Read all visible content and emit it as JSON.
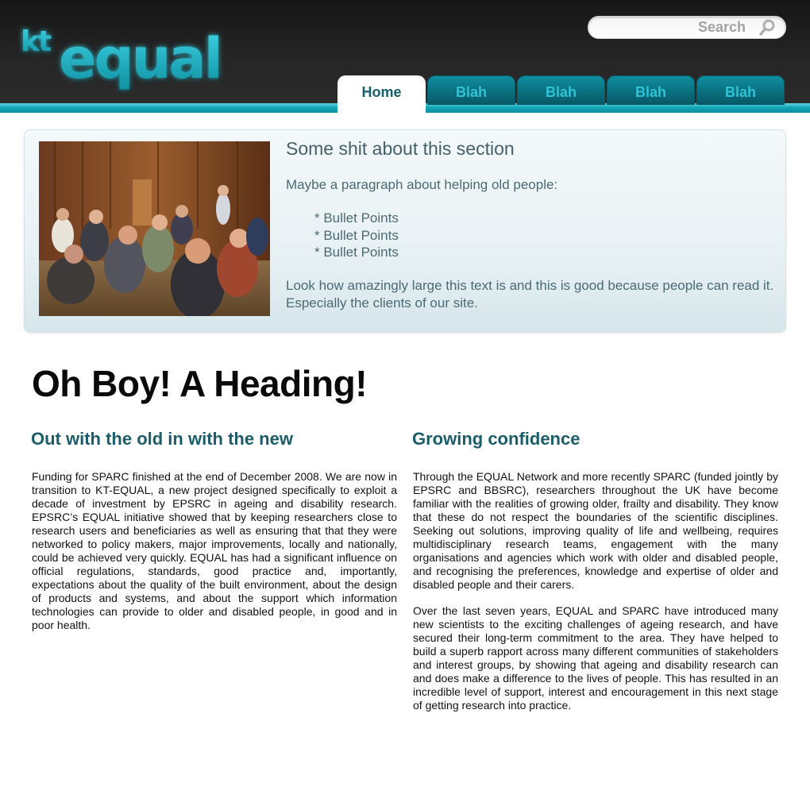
{
  "header": {
    "logo": {
      "prefix": "kt",
      "name": "equal"
    },
    "search": {
      "placeholder": "Search"
    },
    "tabs": [
      {
        "label": "Home",
        "active": true
      },
      {
        "label": "Blah",
        "active": false
      },
      {
        "label": "Blah",
        "active": false
      },
      {
        "label": "Blah",
        "active": false
      },
      {
        "label": "Blah",
        "active": false
      }
    ]
  },
  "intro": {
    "title": "Some shit about this section",
    "lead": "Maybe a paragraph about helping old people:",
    "bullets": [
      "* Bullet Points",
      "* Bullet Points",
      "* Bullet Points"
    ],
    "closing": "Look how amazingly large this text is and this is good because people can read it. Especially the clients of our site."
  },
  "main": {
    "heading": "Oh Boy! A Heading!",
    "columns": [
      {
        "title": "Out with the old in with the new",
        "paragraphs": [
          "Funding for SPARC finished at the end of December 2008. We are now in transition to KT-EQUAL, a new project designed specifically to exploit a decade of investment by EPSRC in ageing and disability research. EPSRC’s EQUAL initiative showed that by keeping researchers close to research users and beneficiaries as well as ensuring that that they were net­worked to policy makers, major improvements, locally and nationally, could be achieved very quickly. EQUAL has had a significant influence on official regulations, standards, good practice and, importantly, expectations about the quality of the built environment, about the design of products and sys­tems, and about the support which information technologies can provide to older and disabled people, in good and in poor health."
        ]
      },
      {
        "title": "Growing confidence",
        "paragraphs": [
          "Through the EQUAL Network and more recently SPARC (funded jointly by EPSRC and BBSRC), researchers throughout the UK have become familiar with the realities of growing older, frailty and disability. They know that these do not respect the boundaries of the scientific disciplines. Seeking out solu­tions, improving quality of life and wellbeing, requires multidisciplinary research teams, engagement with the many organisations and agencies which work with older and disabled people, and recognising the prefer­ences, knowledge and expertise of older and disabled people and their carers.",
          "Over the last seven years, EQUAL and SPARC have introduced many new scientists to the exciting challenges of ageing research, and have secured their long-term commitment to the area. They have helped to build a superb rapport across many different communities of stakeholders and interest groups, by showing that ageing and disability research can and does make a difference to the lives of people. This has resulted in an incredible level of support, interest and encouragement in this next stage of getting research into practice."
        ]
      }
    ]
  },
  "colors": {
    "accent": "#14a6b8",
    "tab_text": "#2fc3d6",
    "heading_teal": "#1c5d6a"
  }
}
